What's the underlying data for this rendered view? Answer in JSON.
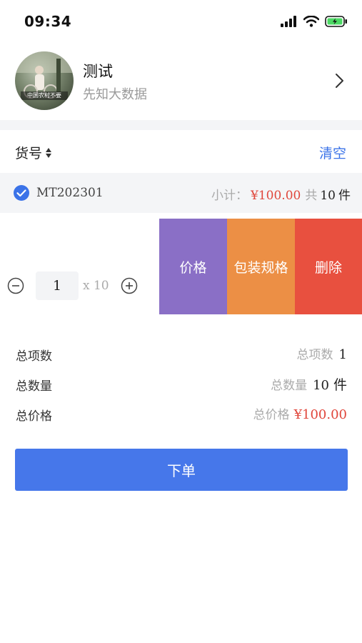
{
  "status_bar": {
    "time": "09:34"
  },
  "profile": {
    "name": "测试",
    "subtitle": "先知大数据",
    "avatar_caption": "中国农村不要"
  },
  "toolbar": {
    "sort_label": "货号",
    "clear_label": "清空"
  },
  "group": {
    "code": "MT202301",
    "subtotal_label": "小计：",
    "subtotal_price": "¥100.00",
    "total_prefix": "共",
    "total_qty": "10",
    "total_unit": "件"
  },
  "item": {
    "quantity": "1",
    "multiplier": "x 10",
    "actions": {
      "price": "价格",
      "package": "包装规格",
      "delete": "删除"
    }
  },
  "summary": {
    "total_items_label": "总项数",
    "total_items_key": "总项数",
    "total_items_value": "1",
    "total_qty_label": "总数量",
    "total_qty_key": "总数量",
    "total_qty_value": "10",
    "total_qty_unit": "件",
    "total_price_label": "总价格",
    "total_price_key": "总价格",
    "total_price_value": "¥100.00"
  },
  "order_button": "下单",
  "colors": {
    "accent": "#4677ea",
    "price_red": "#e0463b",
    "action_price": "#8a6fc6",
    "action_pack": "#ec8f45",
    "action_delete": "#e8503f"
  }
}
